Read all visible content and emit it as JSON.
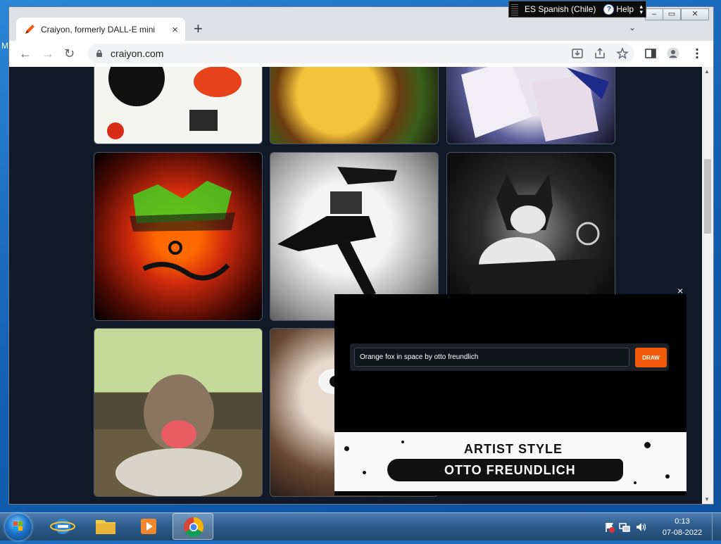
{
  "desktop": {
    "edge_letter": "M"
  },
  "language_bar": {
    "language": "ES Spanish (Chile)",
    "help": "Help",
    "help_icon": "?"
  },
  "browser": {
    "tab": {
      "title": "Craiyon, formerly DALL-E mini",
      "close_icon": "×"
    },
    "new_tab_icon": "+",
    "tab_search_icon": "⌄",
    "nav": {
      "back": "←",
      "forward": "→",
      "reload": "↻"
    },
    "url": "craiyon.com",
    "window_controls": {
      "minimize": "–",
      "restore": "▭",
      "close": "✕"
    }
  },
  "page": {
    "popup": {
      "close": "×",
      "prompt_value": "Orange fox in space by otto freundlich",
      "draw_button": "DRAW",
      "banner_line1": "ARTIST STYLE",
      "banner_line2": "OTTO FREUNDLICH"
    }
  },
  "taskbar": {
    "apps": [
      "Internet Explorer",
      "Windows Explorer",
      "Windows Media Player",
      "Google Chrome"
    ],
    "time": "0:13",
    "date": "07-08-2022"
  },
  "colors": {
    "page_bg": "#111827",
    "draw_button": "#f25b0e",
    "taskbar": "#2b5a8a"
  }
}
